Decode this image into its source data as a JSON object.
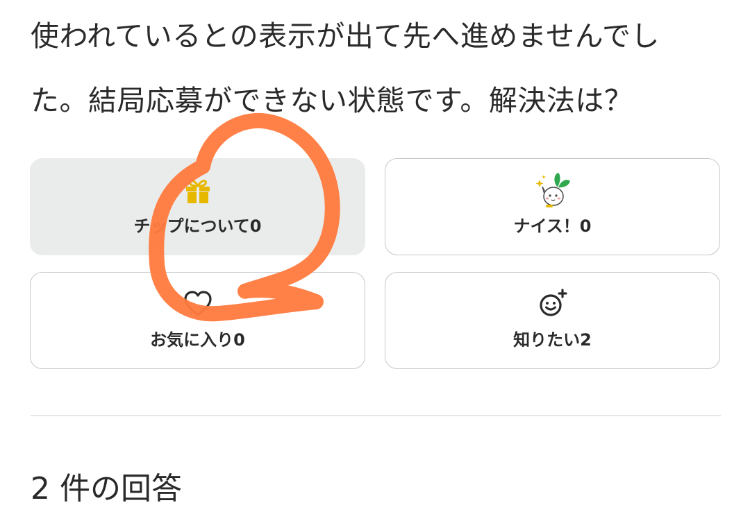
{
  "question": {
    "line1": "使われているとの表示が出て先へ進めませんでし",
    "line2": "た。結局応募ができない状態です。解決法は？"
  },
  "reactions": [
    {
      "icon": "gift-icon",
      "label": "チップについて0",
      "active": true
    },
    {
      "icon": "rabbit-mascot-icon",
      "label": "ナイス！0",
      "active": false
    },
    {
      "icon": "heart-icon",
      "label": "お気に入り0",
      "active": false
    },
    {
      "icon": "smiley-plus-icon",
      "label": "知りたい2",
      "active": false
    }
  ],
  "answers": {
    "heading": "2 件の回答"
  },
  "colors": {
    "gift": "#e6b800",
    "annotation": "#ff7a3d",
    "active_bg": "#eaeceb",
    "mascot_leaf": "#2fa84f"
  }
}
